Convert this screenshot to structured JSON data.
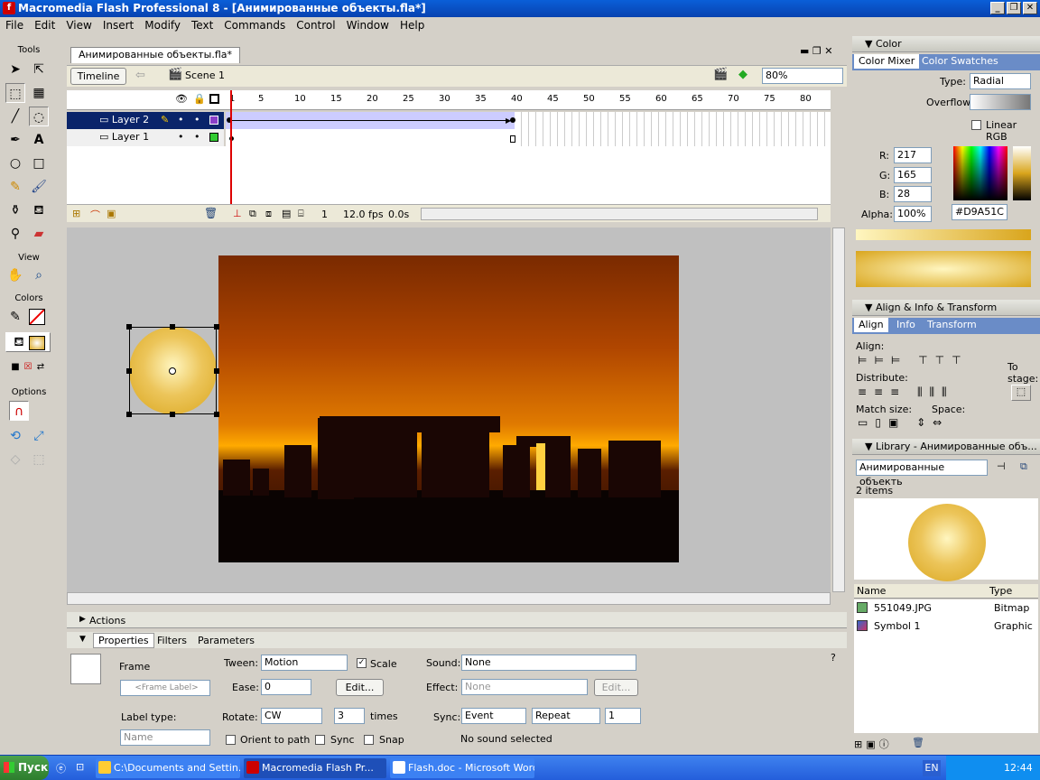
{
  "window": {
    "title": "Macromedia Flash Professional 8 - [Анимированные объекты.fla*]",
    "logo": "f"
  },
  "menu": [
    "File",
    "Edit",
    "View",
    "Insert",
    "Modify",
    "Text",
    "Commands",
    "Control",
    "Window",
    "Help"
  ],
  "tools": {
    "title": "Tools",
    "view": "View",
    "colors": "Colors",
    "options": "Options"
  },
  "document": {
    "tab": "Анимированные объекты.fla*",
    "timeline_btn": "Timeline",
    "scene": "Scene 1",
    "zoom": "80%"
  },
  "timeline": {
    "ruler": [
      "1",
      "5",
      "10",
      "15",
      "20",
      "25",
      "30",
      "35",
      "40",
      "45",
      "50",
      "55",
      "60",
      "65",
      "70",
      "75",
      "80"
    ],
    "layers": [
      {
        "name": "Layer 2",
        "selected": true,
        "color": "#8a3fc8"
      },
      {
        "name": "Layer 1",
        "selected": false,
        "color": "#33cc33"
      }
    ],
    "frame": "1",
    "fps": "12.0 fps",
    "time": "0.0s"
  },
  "color_panel": {
    "title": "Color",
    "tab_mixer": "Color Mixer",
    "tab_swatches": "Color Swatches",
    "type_label": "Type:",
    "type_value": "Radial",
    "overflow_label": "Overflow:",
    "linear_rgb": "Linear RGB",
    "r_label": "R:",
    "r": "217",
    "g_label": "G:",
    "g": "165",
    "b_label": "B:",
    "b": "28",
    "alpha_label": "Alpha:",
    "alpha": "100%",
    "hex": "#D9A51C"
  },
  "align_panel": {
    "title": "Align & Info & Transform",
    "tab_align": "Align",
    "tab_info": "Info",
    "tab_transform": "Transform",
    "align": "Align:",
    "distribute": "Distribute:",
    "match": "Match size:",
    "space": "Space:",
    "to_stage": "To stage:"
  },
  "library": {
    "title": "Library - Анимированные объ...",
    "dropdown": "Анимированные объекть",
    "count": "2 items",
    "col_name": "Name",
    "col_type": "Type",
    "items": [
      {
        "name": "551049.JPG",
        "type": "Bitmap"
      },
      {
        "name": "Symbol 1",
        "type": "Graphic"
      }
    ]
  },
  "actions": {
    "title": "Actions"
  },
  "properties": {
    "tab_props": "Properties",
    "tab_filters": "Filters",
    "tab_params": "Parameters",
    "frame": "Frame",
    "frame_label_ph": "<Frame Label>",
    "label_type": "Label type:",
    "label_type_val": "Name",
    "tween": "Tween:",
    "tween_val": "Motion",
    "scale": "Scale",
    "ease": "Ease:",
    "ease_val": "0",
    "edit": "Edit...",
    "rotate": "Rotate:",
    "rotate_val": "CW",
    "rotate_times": "3",
    "times": "times",
    "orient": "Orient to path",
    "sync_chk": "Sync",
    "snap": "Snap",
    "sound": "Sound:",
    "sound_val": "None",
    "effect": "Effect:",
    "effect_val": "None",
    "edit2": "Edit...",
    "sync": "Sync:",
    "sync_val": "Event",
    "repeat_val": "Repeat",
    "repeat_n": "1",
    "no_sound": "No sound selected"
  },
  "taskbar": {
    "start": "Пуск",
    "items": [
      "C:\\Documents and Settin...",
      "Macromedia Flash Pr...",
      "Flash.doc - Microsoft Word"
    ],
    "lang": "EN",
    "clock": "12:44"
  }
}
